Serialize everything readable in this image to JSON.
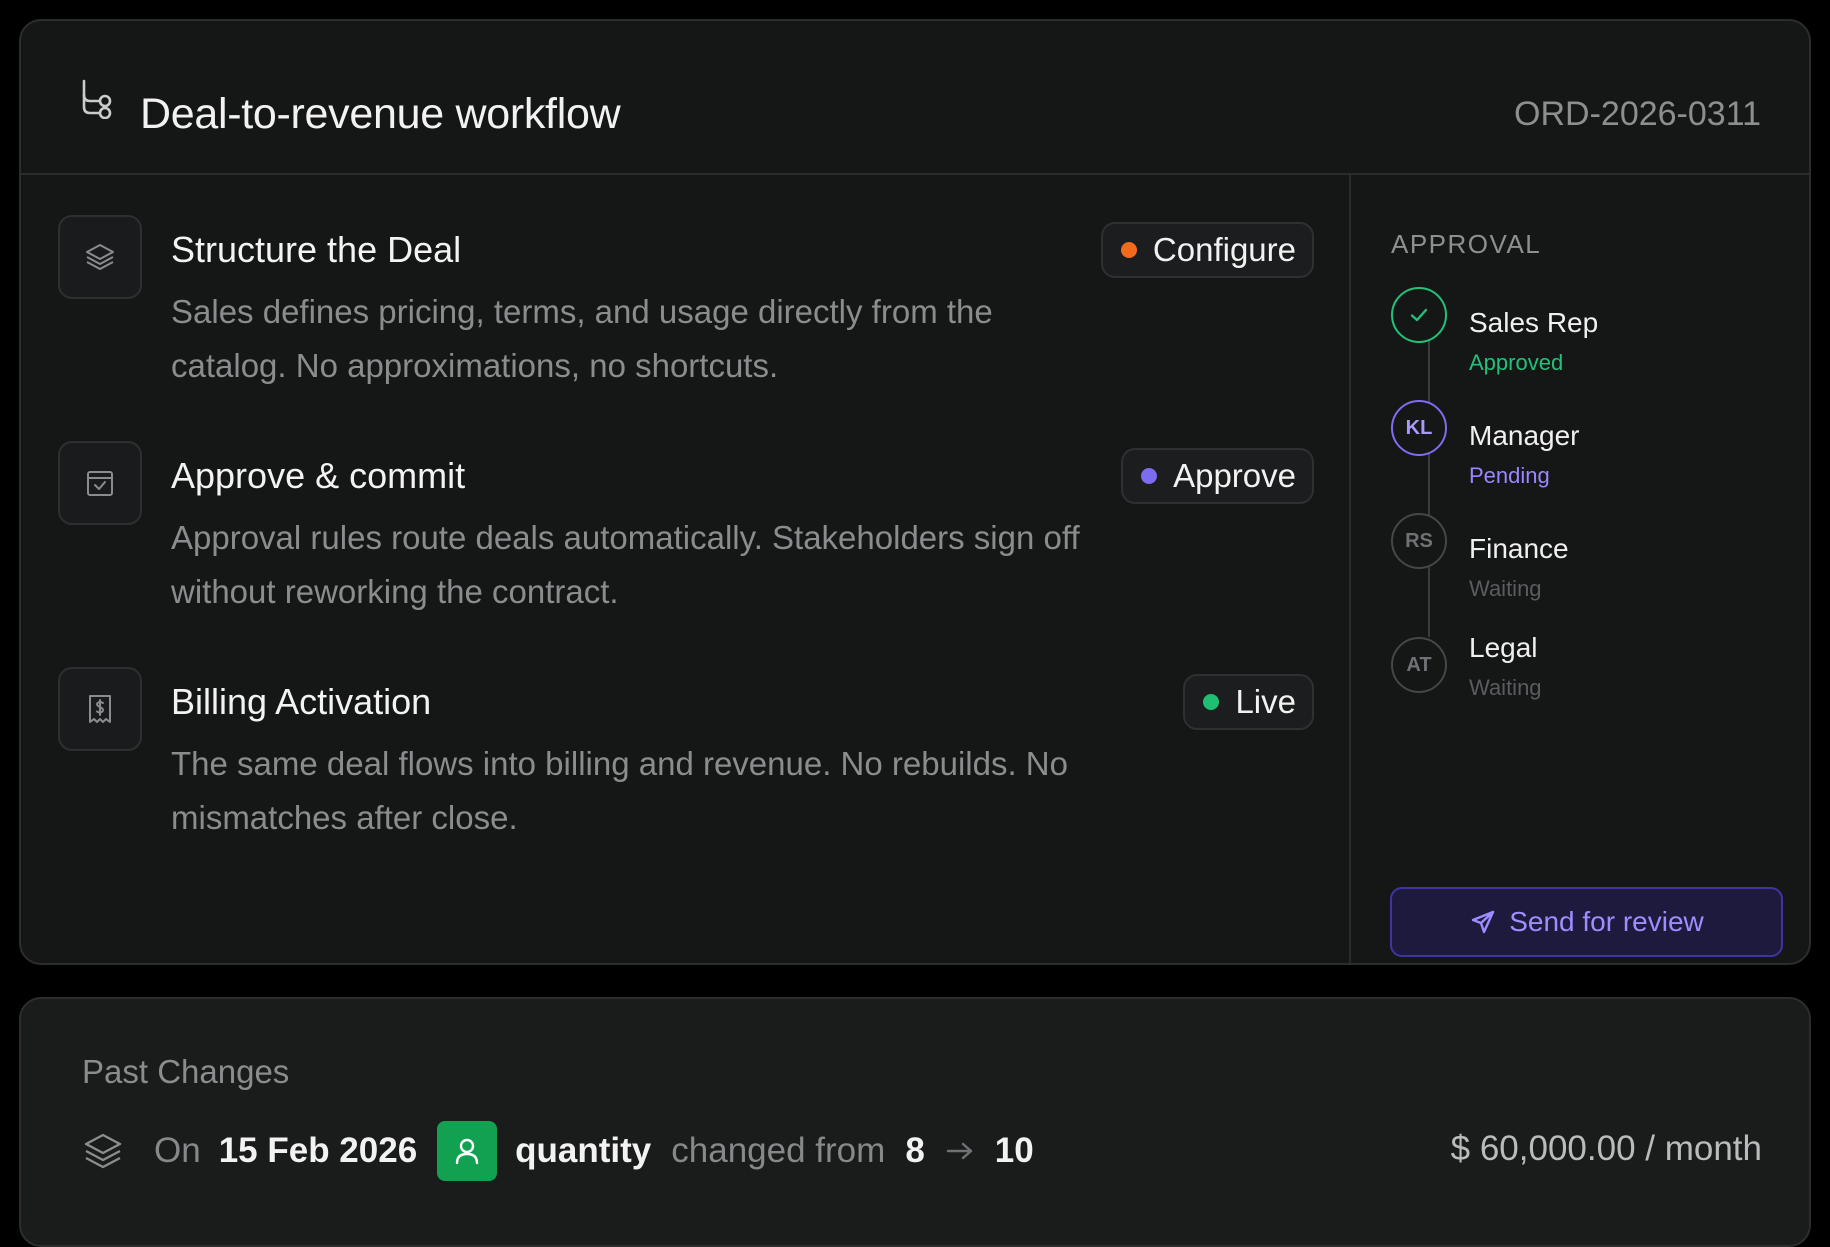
{
  "header": {
    "title": "Deal-to-revenue workflow",
    "order_id": "ORD-2026-0311",
    "icon": "workflow-icon"
  },
  "steps": [
    {
      "title": "Structure the Deal",
      "description": "Sales defines pricing, terms, and usage directly from the catalog. No approximations, no shortcuts.",
      "badge": "Configure",
      "badge_color": "#f26b1d",
      "icon": "layers-icon"
    },
    {
      "title": "Approve & commit",
      "description": "Approval rules route deals automatically. Stakeholders sign off without reworking the contract.",
      "badge": "Approve",
      "badge_color": "#7c6cf0",
      "icon": "calendar-check-icon"
    },
    {
      "title": "Billing Activation",
      "description": "The same deal flows into billing and revenue. No rebuilds. No mismatches after close.",
      "badge": "Live",
      "badge_color": "#1fbf73",
      "icon": "receipt-dollar-icon"
    }
  ],
  "approval": {
    "label": "APPROVAL",
    "approvers": [
      {
        "initials": "",
        "name": "Sales Rep",
        "status": "Approved",
        "status_color": "#22c079"
      },
      {
        "initials": "KL",
        "name": "Manager",
        "status": "Pending",
        "status_color": "#9a86ff"
      },
      {
        "initials": "RS",
        "name": "Finance",
        "status": "Waiting",
        "status_color": "#55575a"
      },
      {
        "initials": "AT",
        "name": "Legal",
        "status": "Waiting",
        "status_color": "#55575a"
      }
    ],
    "send_label": "Send for review"
  },
  "changes": {
    "title": "Past Changes",
    "prefix": "On",
    "date": "15 Feb 2026",
    "field": "quantity",
    "verb": "changed from",
    "from": "8",
    "to": "10",
    "price": "$ 60,000.00 / month"
  }
}
